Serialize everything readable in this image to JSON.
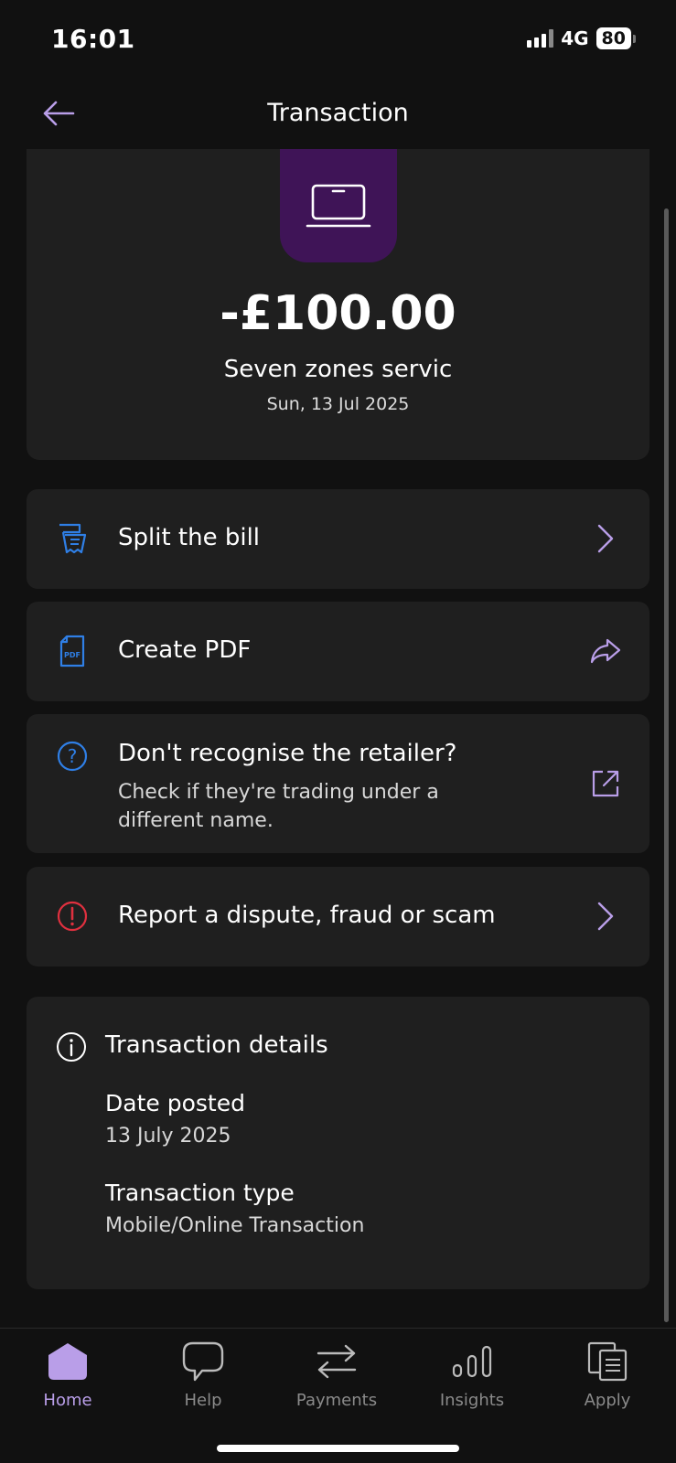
{
  "status_bar": {
    "time": "16:01",
    "network": "4G",
    "battery": "80"
  },
  "header": {
    "title": "Transaction",
    "back_icon": "arrow-left-icon"
  },
  "transaction": {
    "merchant_icon": "laptop-icon",
    "amount": "-£100.00",
    "merchant": "Seven zones servic",
    "date": "Sun, 13 Jul 2025"
  },
  "actions": [
    {
      "label": "Split the bill",
      "icon": "split-bill-icon",
      "trail_icon": "chevron-right-icon"
    },
    {
      "label": "Create PDF",
      "icon": "pdf-icon",
      "trail_icon": "share-icon"
    },
    {
      "label": "Don't recognise the retailer?",
      "sub": "Check if they're trading under a different name.",
      "icon": "help-circle-icon",
      "trail_icon": "external-link-icon"
    },
    {
      "label": "Report a dispute, fraud or scam",
      "icon": "alert-circle-icon",
      "trail_icon": "chevron-right-icon"
    }
  ],
  "details": {
    "heading": "Transaction details",
    "date_posted_label": "Date posted",
    "date_posted_value": "13 July 2025",
    "type_label": "Transaction type",
    "type_value": "Mobile/Online Transaction"
  },
  "tabs": [
    {
      "label": "Home",
      "icon": "home-icon",
      "active": true
    },
    {
      "label": "Help",
      "icon": "chat-bubble-icon",
      "active": false
    },
    {
      "label": "Payments",
      "icon": "transfer-arrows-icon",
      "active": false
    },
    {
      "label": "Insights",
      "icon": "bar-insights-icon",
      "active": false
    },
    {
      "label": "Apply",
      "icon": "documents-icon",
      "active": false
    }
  ],
  "colors": {
    "accent": "#b99ee8",
    "blue_icon": "#2f7fe6",
    "alert_red": "#e0303f",
    "merchant_tile": "#3f1457",
    "card_bg": "#1f1f1f",
    "background": "#111111"
  }
}
